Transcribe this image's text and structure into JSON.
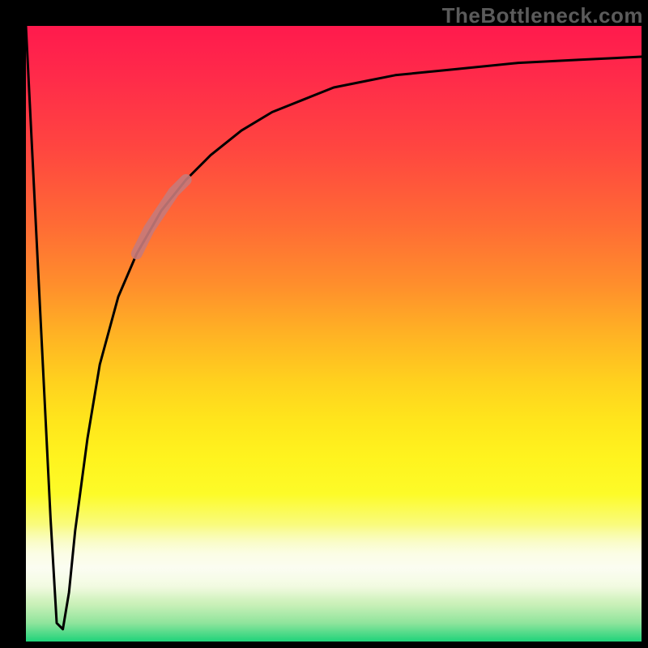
{
  "watermark": "TheBottleneck.com",
  "colors": {
    "frame": "#000000",
    "curve": "#000000",
    "highlight": "#c77a7a",
    "gradient_top": "#ff1a4d",
    "gradient_mid": "#ffe51c",
    "gradient_bottom": "#1fd37a"
  },
  "chart_data": {
    "type": "line",
    "title": "",
    "xlabel": "",
    "ylabel": "",
    "xlim": [
      0,
      100
    ],
    "ylim": [
      0,
      100
    ],
    "grid": false,
    "series": [
      {
        "name": "bottleneck-curve",
        "x": [
          0,
          2,
          4,
          5,
          6,
          7,
          8,
          10,
          12,
          15,
          18,
          22,
          26,
          30,
          35,
          40,
          45,
          50,
          55,
          60,
          70,
          80,
          90,
          100
        ],
        "values": [
          100,
          60,
          20,
          3,
          2,
          8,
          18,
          33,
          45,
          56,
          63,
          70,
          75,
          79,
          83,
          86,
          88,
          90,
          91,
          92,
          93,
          94,
          94.5,
          95
        ]
      },
      {
        "name": "highlight-segment",
        "x": [
          18,
          20,
          22,
          24,
          26
        ],
        "values": [
          63,
          67,
          70,
          73,
          75
        ]
      }
    ],
    "annotations": []
  }
}
